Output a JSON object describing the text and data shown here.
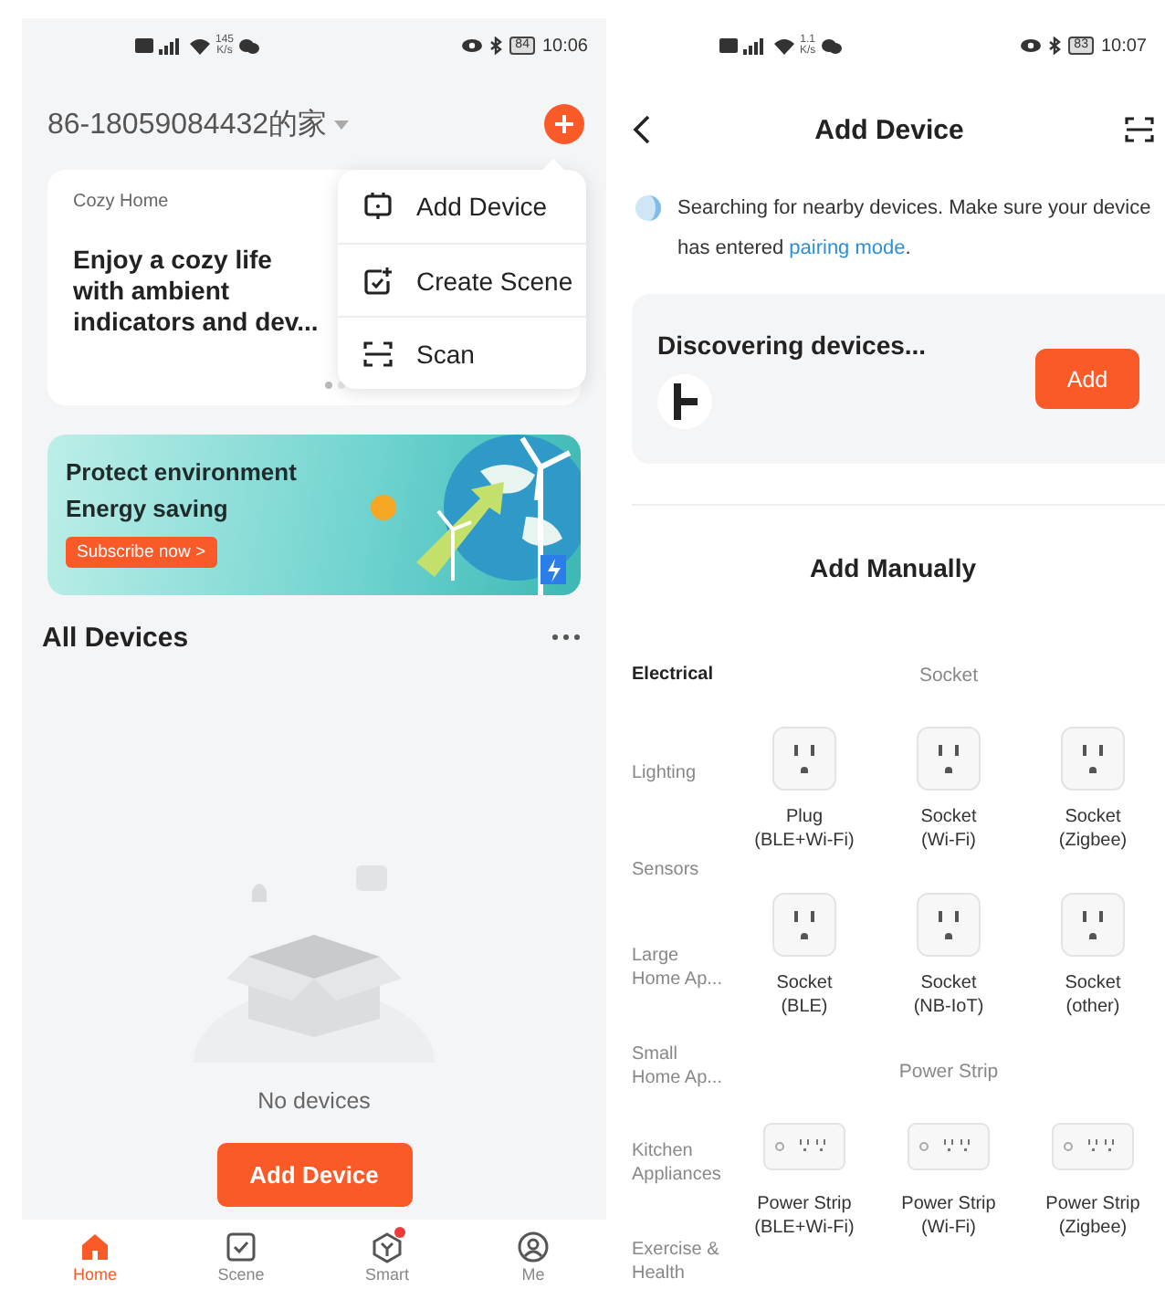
{
  "home": {
    "status_bar": {
      "speed": "145",
      "speed_unit": "K/s",
      "battery": "84",
      "time": "10:06"
    },
    "home_name": "86-18059084432的家",
    "card": {
      "label": "Cozy Home",
      "text": "Enjoy a cozy life with ambient indicators and dev...",
      "dots": [
        {
          "selected": true
        },
        {
          "selected": false
        }
      ]
    },
    "menu": [
      {
        "kind": "device",
        "label": "Add Device"
      },
      {
        "kind": "scene",
        "label": "Create Scene"
      },
      {
        "kind": "scan",
        "label": "Scan"
      }
    ],
    "banner": {
      "title": "Protect environment",
      "subtitle": "Energy saving",
      "button": "Subscribe now >"
    },
    "section_title": "All Devices",
    "empty_text": "No devices",
    "add_button": "Add Device",
    "tabs": [
      {
        "kind": "home",
        "label": "Home",
        "selected": true,
        "badge": false
      },
      {
        "kind": "scene",
        "label": "Scene",
        "selected": false,
        "badge": false
      },
      {
        "kind": "smart",
        "label": "Smart",
        "selected": false,
        "badge": true
      },
      {
        "kind": "me",
        "label": "Me",
        "selected": false,
        "badge": false
      }
    ]
  },
  "add_device": {
    "status_bar": {
      "speed": "1.1",
      "speed_unit": "K/s",
      "battery": "83",
      "time": "10:07"
    },
    "title": "Add Device",
    "notice": {
      "text": "Searching for nearby devices. Make sure your device has entered",
      "link": "pairing mode",
      "end": "."
    },
    "discovering": {
      "title": "Discovering devices...",
      "button": "Add"
    },
    "manual_title": "Add Manually",
    "categories": [
      {
        "label": "Electrical",
        "selected": true
      },
      {
        "label": "Lighting",
        "selected": false
      },
      {
        "label": "Sensors",
        "selected": false
      },
      {
        "label": "Large Home Ap...",
        "selected": false
      },
      {
        "label": "Small Home Ap...",
        "selected": false
      },
      {
        "label": "Kitchen Appliances",
        "selected": false
      },
      {
        "label": "Exercise & Health",
        "selected": false
      }
    ],
    "groups": [
      {
        "title": "Socket",
        "items": [
          {
            "kind": "socket",
            "name": "Plug",
            "protocol": "(BLE+Wi-Fi)"
          },
          {
            "kind": "socket",
            "name": "Socket",
            "protocol": "(Wi-Fi)"
          },
          {
            "kind": "socket",
            "name": "Socket",
            "protocol": "(Zigbee)"
          },
          {
            "kind": "socket",
            "name": "Socket",
            "protocol": "(BLE)"
          },
          {
            "kind": "socket",
            "name": "Socket",
            "protocol": "(NB-IoT)"
          },
          {
            "kind": "socket",
            "name": "Socket",
            "protocol": "(other)"
          }
        ]
      },
      {
        "title": "Power Strip",
        "items": [
          {
            "kind": "strip",
            "name": "Power Strip",
            "protocol": "(BLE+Wi-Fi)"
          },
          {
            "kind": "strip",
            "name": "Power Strip",
            "protocol": "(Wi-Fi)"
          },
          {
            "kind": "strip",
            "name": "Power Strip",
            "protocol": "(Zigbee)"
          }
        ]
      }
    ]
  }
}
